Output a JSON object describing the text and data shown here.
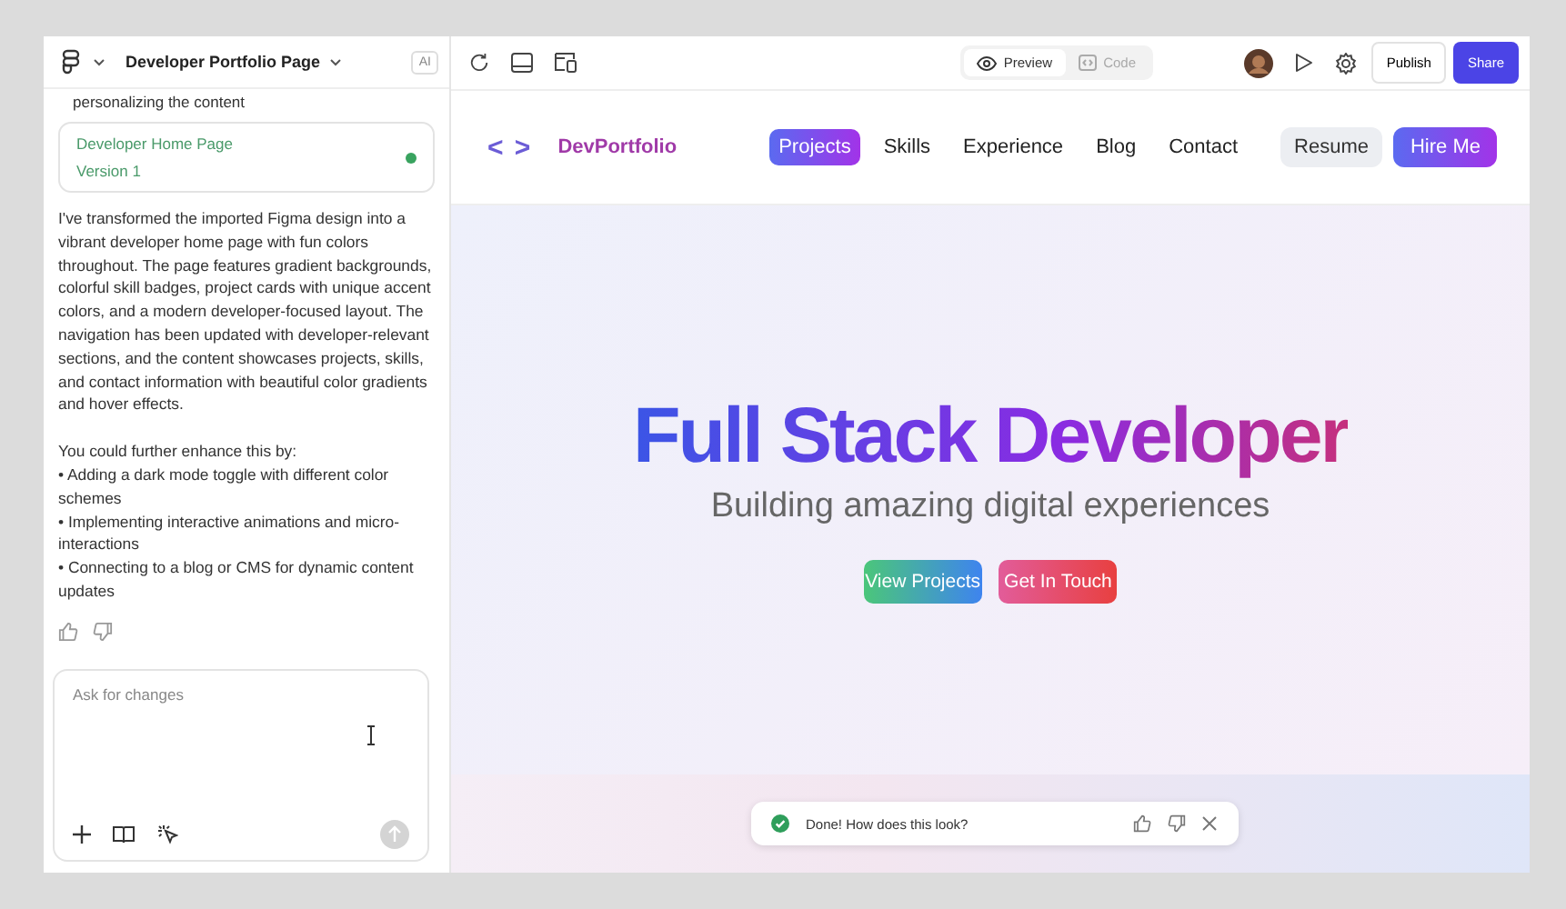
{
  "project": {
    "title": "Developer Portfolio Page",
    "ai_badge": "AI"
  },
  "chat": {
    "previous_tail": "personalizing the content",
    "version_card": {
      "title": "Developer Home Page",
      "version": "Version 1"
    },
    "message": [
      "I've transformed the imported Figma design into a vibrant developer home page with fun colors throughout. The page features gradient backgrounds, colorful skill badges, project cards with unique accent colors, and a modern developer-focused layout. The navigation has been updated with developer-relevant sections, and the content showcases projects, skills, and contact information with beautiful color gradients and hover effects.",
      "You could further enhance this by:",
      "• Adding a dark mode toggle with different color schemes",
      "• Implementing interactive animations and micro-interactions",
      "• Connecting to a blog or CMS for dynamic content updates"
    ],
    "input": {
      "placeholder": "Ask for changes"
    }
  },
  "view_tabs": [
    {
      "label": "Preview",
      "selected": true
    },
    {
      "label": "Code",
      "selected": false
    }
  ],
  "toolbar": {
    "publish": "Publish",
    "share": "Share"
  },
  "site": {
    "logo_mark": "< >",
    "brand": "DevPortfolio",
    "nav": [
      {
        "label": "Projects",
        "selected": true
      },
      {
        "label": "Skills",
        "selected": false
      },
      {
        "label": "Experience",
        "selected": false
      },
      {
        "label": "Blog",
        "selected": false
      },
      {
        "label": "Contact",
        "selected": false
      }
    ],
    "resume": "Resume",
    "hire": "Hire Me",
    "hero_title": "Full Stack Developer",
    "hero_subtitle": "Building amazing digital experiences",
    "buttons": [
      "View Projects",
      "Get In Touch"
    ]
  },
  "toast": {
    "text": "Done! How does this look?"
  }
}
